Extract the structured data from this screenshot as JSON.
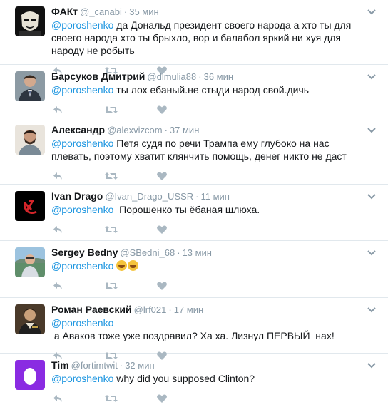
{
  "tweets": [
    {
      "name": "ФАКт",
      "handle": "@_canabi",
      "time": "35 мин",
      "mention": "@poroshenko",
      "text": " да Дональд президент своего народа а хто ты для своего народа хто ты брыхло, вор и балабол яркий ни хуя для народу не робыть",
      "avatar": "mask-avatar"
    },
    {
      "name": "Барсуков Дмитрий",
      "handle": "@dimulia88",
      "time": "36 мин",
      "mention": "@poroshenko",
      "text": " ты лох ебаный.не стыди народ свой.дичь",
      "avatar": "suit-man-avatar"
    },
    {
      "name": "Александр",
      "handle": "@alexvizcom",
      "time": "37 мин",
      "mention": "@poroshenko",
      "text": " Петя судя по речи Трампа ему глубоко на нас плевать, поэтому хватит клянчить помощь, денег никто не даст",
      "avatar": "bearded-man-avatar"
    },
    {
      "name": "Ivan Drago",
      "handle": "@Ivan_Drago_USSR",
      "time": "11 мин",
      "mention": "@poroshenko",
      "text": "  Порошенко ты ёбаная шлюха.",
      "avatar": "hammer-sickle-avatar"
    },
    {
      "name": "Sergey Bedny",
      "handle": "@SBedni_68",
      "time": "13 мин",
      "mention": "@poroshenko",
      "text": " ",
      "emoji_count": 2,
      "avatar": "beach-man-avatar"
    },
    {
      "name": "Роман Раевский",
      "handle": "@lrf021",
      "time": "17 мин",
      "mention": "@poroshenko",
      "text": " а Аваков тоже уже поздравил? Ха ха. Лизнул ПЕРВЫЙ  нах!",
      "avatar": "portrait-avatar"
    },
    {
      "name": "Tim",
      "handle": "@fortimtwit",
      "time": "32 мин",
      "mention": "@poroshenko",
      "text": " why did you supposed Clinton?",
      "avatar": "egg-avatar"
    }
  ],
  "separator": "·",
  "colors": {
    "link": "#1b95e0",
    "meta": "#8899a6",
    "icon": "#aab8c2",
    "divider": "#e1e8ed"
  }
}
